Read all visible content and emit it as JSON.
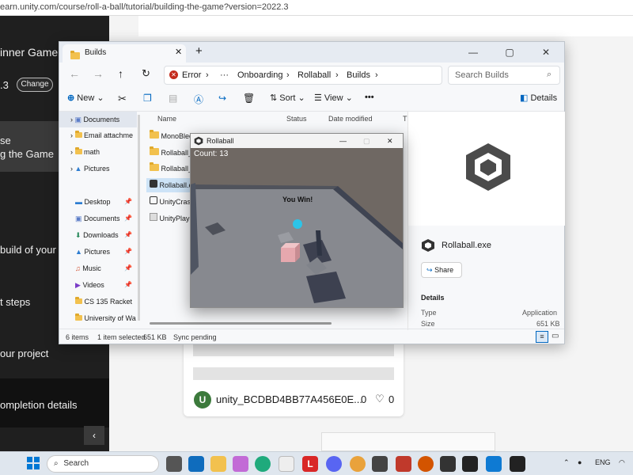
{
  "browser": {
    "url": "earn.unity.com/course/roll-a-ball/tutorial/building-the-game?version=2022.3"
  },
  "sidebar": {
    "course_title": "inner Game: R",
    "version": ".3",
    "change_label": "Change",
    "items": [
      {
        "line1": "se",
        "line2": "g the Game"
      },
      {
        "line1": "build of your c"
      },
      {
        "line1": "t steps"
      },
      {
        "line1": "our project"
      },
      {
        "line1": "ompletion details"
      }
    ],
    "collapse_icon": "chevron-left-icon"
  },
  "comment": {
    "avatar_letter": "U",
    "username": "unity_BCDBD4BB77A456E0E...",
    "count_a": "0",
    "count_b": "0"
  },
  "explorer": {
    "tab_title": "Builds",
    "breadcrumb": {
      "error": "Error",
      "more": "···",
      "path": [
        "Onboarding",
        "Rollaball",
        "Builds"
      ]
    },
    "search_placeholder": "Search Builds",
    "toolbar": {
      "new": "New",
      "sort": "Sort",
      "view": "View",
      "more": "•••",
      "details": "Details"
    },
    "nav_items": [
      {
        "label": "Documents",
        "icon": "documents-icon"
      },
      {
        "label": "Email attachme",
        "icon": "folder-icon"
      },
      {
        "label": "math",
        "icon": "folder-icon"
      },
      {
        "label": "Pictures",
        "icon": "pictures-icon"
      },
      {
        "label": "Desktop",
        "icon": "desktop-icon"
      },
      {
        "label": "Documents",
        "icon": "documents-icon"
      },
      {
        "label": "Downloads",
        "icon": "downloads-icon"
      },
      {
        "label": "Pictures",
        "icon": "pictures-icon"
      },
      {
        "label": "Music",
        "icon": "music-icon"
      },
      {
        "label": "Videos",
        "icon": "videos-icon"
      },
      {
        "label": "CS 135 Racket",
        "icon": "folder-icon"
      },
      {
        "label": "University of Wa",
        "icon": "folder-icon"
      }
    ],
    "columns": {
      "name": "Name",
      "status": "Status",
      "date": "Date modified",
      "type": "T"
    },
    "files": [
      {
        "name": "MonoBleed"
      },
      {
        "name": "Rollaball_B"
      },
      {
        "name": "Rollaball_D"
      },
      {
        "name": "Rollaball.ex"
      },
      {
        "name": "UnityCrash"
      },
      {
        "name": "UnityPlaye"
      }
    ],
    "details_panel": {
      "file_name": "Rollaball.exe",
      "share": "Share",
      "section": "Details",
      "type_label": "Type",
      "type_value": "Application",
      "size_label": "Size",
      "size_value": "651 KB"
    },
    "status": {
      "items": "6 items",
      "selected": "1 item selected",
      "size": "651 KB",
      "sync": "Sync pending"
    }
  },
  "game": {
    "title": "Rollaball",
    "count_text": "Count: 13",
    "win_text": "You Win!"
  },
  "taskbar": {
    "search_placeholder": "Search",
    "lang": "ENG"
  },
  "colors": {
    "accent": "#0067c0",
    "error": "#c42b1c",
    "sidebar_bg": "#1f1f1f"
  }
}
